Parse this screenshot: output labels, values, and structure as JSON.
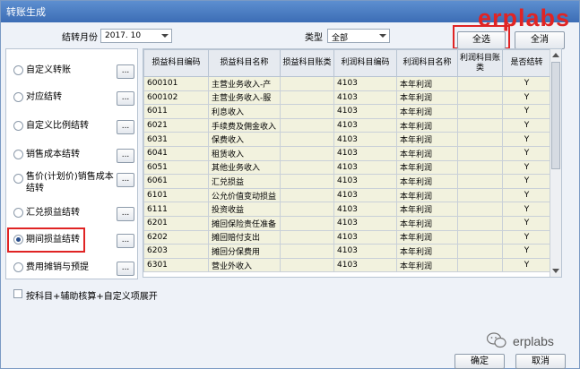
{
  "window": {
    "title": "转账生成"
  },
  "brand": {
    "logo_text": "erplabs",
    "color": "#e02424"
  },
  "filters": {
    "month_label": "结转月份",
    "month_value": "2017. 10",
    "type_label": "类型",
    "type_value": "全部"
  },
  "buttons": {
    "select_all": "全选",
    "clear_all": "全消",
    "ok": "确定",
    "cancel": "取消",
    "dots": "..."
  },
  "transfer_types": [
    {
      "label": "自定义转账",
      "checked": false,
      "has_button": true
    },
    {
      "label": "对应结转",
      "checked": false,
      "has_button": true
    },
    {
      "label": "自定义比例结转",
      "checked": false,
      "has_button": true
    },
    {
      "label": "销售成本结转",
      "checked": false,
      "has_button": true
    },
    {
      "label": "售价(计划价)销售成本结转",
      "checked": false,
      "has_button": true
    },
    {
      "label": "汇兑损益结转",
      "checked": false,
      "has_button": true
    },
    {
      "label": "期间损益结转",
      "checked": true,
      "has_button": true
    },
    {
      "label": "费用摊销与预提",
      "checked": false,
      "has_button": true
    }
  ],
  "table": {
    "headers": [
      "损益科目编码",
      "损益科目名称",
      "损益科目账类",
      "利润科目编码",
      "利润科目名称",
      "利润科目账类",
      "是否结转"
    ],
    "rows": [
      [
        "600101",
        "主营业务收入-产",
        "",
        "4103",
        "本年利润",
        "",
        "Y"
      ],
      [
        "600102",
        "主营业务收入-服",
        "",
        "4103",
        "本年利润",
        "",
        "Y"
      ],
      [
        "6011",
        "利息收入",
        "",
        "4103",
        "本年利润",
        "",
        "Y"
      ],
      [
        "6021",
        "手续费及佣金收入",
        "",
        "4103",
        "本年利润",
        "",
        "Y"
      ],
      [
        "6031",
        "保费收入",
        "",
        "4103",
        "本年利润",
        "",
        "Y"
      ],
      [
        "6041",
        "租赁收入",
        "",
        "4103",
        "本年利润",
        "",
        "Y"
      ],
      [
        "6051",
        "其他业务收入",
        "",
        "4103",
        "本年利润",
        "",
        "Y"
      ],
      [
        "6061",
        "汇兑损益",
        "",
        "4103",
        "本年利润",
        "",
        "Y"
      ],
      [
        "6101",
        "公允价值变动损益",
        "",
        "4103",
        "本年利润",
        "",
        "Y"
      ],
      [
        "6111",
        "投资收益",
        "",
        "4103",
        "本年利润",
        "",
        "Y"
      ],
      [
        "6201",
        "摊回保险责任准备",
        "",
        "4103",
        "本年利润",
        "",
        "Y"
      ],
      [
        "6202",
        "摊回赔付支出",
        "",
        "4103",
        "本年利润",
        "",
        "Y"
      ],
      [
        "6203",
        "摊回分保费用",
        "",
        "4103",
        "本年利润",
        "",
        "Y"
      ],
      [
        "6301",
        "营业外收入",
        "",
        "4103",
        "本年利润",
        "",
        "Y"
      ]
    ]
  },
  "options": {
    "expand_label": "按科目+辅助核算+自定义项展开"
  },
  "watermark": {
    "text": "erplabs"
  }
}
